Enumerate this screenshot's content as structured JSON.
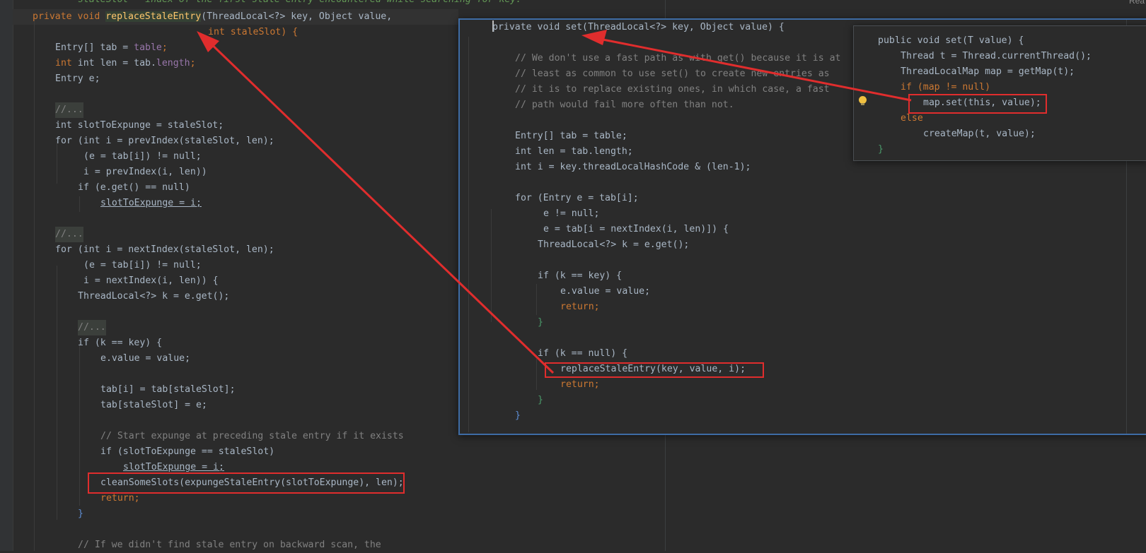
{
  "left_code": {
    "doc_fragment": "staleSlot – index of the first stale entry encountered while searching for key.",
    "sig1_a": "private void ",
    "sig1_fn": "replaceStaleEntry",
    "sig1_b": "(ThreadLocal<?> key, Object value,",
    "sig2": "int staleSlot) {",
    "l_tab": "Entry[] tab = ",
    "l_tab_f": "table",
    "l_len": "int len = tab.",
    "l_len_f": "length",
    "l_e": "Entry e;",
    "fold1": "//...",
    "l_slot": "int slotToExpunge = staleSlot;",
    "l_for1": "for (int i = prevIndex(staleSlot, len);",
    "l_for1b": "(e = tab[i]) != null;",
    "l_for1c": "i = prevIndex(i, len))",
    "l_if1": "if (e.get() == null)",
    "l_assign1": "slotToExpunge = i;",
    "fold2": "//...",
    "l_for2": "for (int i = nextIndex(staleSlot, len);",
    "l_for2b": "(e = tab[i]) != null;",
    "l_for2c": "i = nextIndex(i, len)) {",
    "l_k": "ThreadLocal<?> k = e.get();",
    "fold3": "//...",
    "l_ifk": "if (k == key) {",
    "l_ev": "e.value = value;",
    "l_tab1": "tab[i] = tab[staleSlot];",
    "l_tab2": "tab[staleSlot] = e;",
    "l_cmt": "// Start expunge at preceding stale entry if it exists",
    "l_if2": "if (slotToExpunge == staleSlot)",
    "l_assign2": "slotToExpunge = i;",
    "l_clean": "cleanSomeSlots(expungeStaleEntry(slotToExpunge), len);",
    "l_ret": "return;",
    "l_close": "}",
    "l_cmt2": "// If we didn't find stale entry on backward scan, the"
  },
  "main_popup": {
    "sig": "private void set(ThreadLocal<?> key, Object value) {",
    "c1": "// We don't use a fast path as with get() because it is at",
    "c2": "// least as common to use set() to create new entries as",
    "c3": "// it is to replace existing ones, in which case, a fast",
    "c4": "// path would fail more often than not.",
    "tab": "Entry[] tab = table;",
    "len": "int len = tab.length;",
    "idx": "int i = key.threadLocalHashCode & (len-1);",
    "for1": "for (Entry e = tab[i];",
    "for2": "e != null;",
    "for3": "e = tab[i = nextIndex(i, len)]) {",
    "k": "ThreadLocal<?> k = e.get();",
    "ifkey": "if (k == key) {",
    "ev": "e.value = value;",
    "ret1": "return;",
    "cb1": "}",
    "ifnull": "if (k == null) {",
    "rse": "replaceStaleEntry(key, value, i);",
    "ret2": "return;",
    "cb2": "}",
    "cb3": "}"
  },
  "small_popup": {
    "sig": "public void set(T value) {",
    "t": "Thread t = Thread.currentThread();",
    "map": "ThreadLocalMap map = getMap(t);",
    "ifmap": "if (map != null)",
    "mapset": "map.set(this, value);",
    "else": "else",
    "create": "createMap(t, value);",
    "close": "}"
  },
  "top_right_label": "Rea",
  "colors": {
    "annotation_red": "#e02d2d",
    "keyword": "#cc7832",
    "method": "#ffc66d",
    "field": "#9876aa",
    "comment": "#808080",
    "number": "#6897bb",
    "popup_border": "#3e6ca5"
  }
}
